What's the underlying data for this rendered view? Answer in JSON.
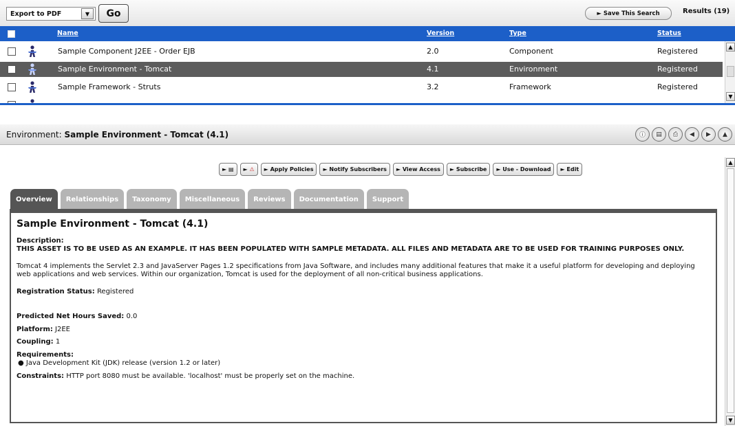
{
  "toolbar": {
    "export_value": "Export to PDF",
    "go_label": "Go",
    "save_search_label": "► Save This Search",
    "results_label": "Results (19)"
  },
  "grid": {
    "columns": {
      "name": "Name",
      "version": "Version",
      "type": "Type",
      "status": "Status"
    },
    "rows": [
      {
        "name": "Sample Component J2EE - Order EJB",
        "version": "2.0",
        "type": "Component",
        "status": "Registered",
        "icon": "asset-person-icon"
      },
      {
        "name": "Sample Environment - Tomcat",
        "version": "4.1",
        "type": "Environment",
        "status": "Registered",
        "icon": "asset-person-icon"
      },
      {
        "name": "Sample Framework - Struts",
        "version": "3.2",
        "type": "Framework",
        "status": "Registered",
        "icon": "asset-person-icon"
      }
    ]
  },
  "detail": {
    "prefix": "Environment:",
    "title": "Sample Environment - Tomcat (4.1)",
    "nav_icons": [
      "info-icon",
      "clipboard-icon",
      "print-icon",
      "previous-icon",
      "next-icon",
      "collapse-icon"
    ],
    "actions": [
      "►",
      "►",
      "► Apply Policies",
      "► Notify Subscribers",
      "► View Access",
      "► Subscribe",
      "► Use - Download",
      "► Edit"
    ],
    "tabs": [
      "Overview",
      "Relationships",
      "Taxonomy",
      "Miscellaneous",
      "Reviews",
      "Documentation",
      "Support"
    ],
    "asset_title": "Sample Environment - Tomcat (4.1)",
    "description_label": "Description:",
    "description_text": "THIS ASSET IS TO BE USED AS AN EXAMPLE. IT HAS BEEN POPULATED WITH SAMPLE METADATA. ALL FILES AND METADATA ARE TO BE USED FOR TRAINING PURPOSES ONLY.",
    "body_text": "Tomcat 4 implements the Servlet 2.3 and JavaServer Pages 1.2 specifications from Java Software, and includes many additional features that make it a useful platform for developing and deploying web applications and web services. Within our organization, Tomcat is used for the deployment of all non-critical business applications.",
    "registration_label": "Registration Status:",
    "registration_value": "Registered",
    "hours_label": "Predicted Net Hours Saved:",
    "hours_value": "0.0",
    "platform_label": "Platform:",
    "platform_value": "J2EE",
    "coupling_label": "Coupling:",
    "coupling_value": "1",
    "requirements_label": "Requirements:",
    "requirements_item": "Java Development Kit (JDK) release (version 1.2 or later)",
    "constraints_label": "Constraints:",
    "constraints_value": "HTTP port 8080 must be available. 'localhost' must be properly set on the machine."
  }
}
